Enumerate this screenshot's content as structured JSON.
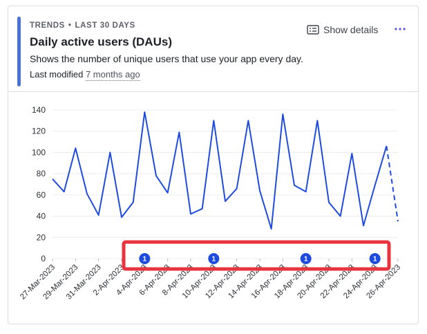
{
  "card": {
    "kicker_type": "TRENDS",
    "kicker_separator": "•",
    "kicker_range": "LAST 30 DAYS",
    "title": "Daily active users (DAUs)",
    "description": "Shows the number of unique users that use your app every day.",
    "modified_prefix": "Last modified",
    "modified_ago": "7 months ago",
    "show_details_label": "Show details",
    "show_details_icon": "details-list-icon",
    "more_icon": "more-dots-icon"
  },
  "colors": {
    "accent": "#4a72d4",
    "line": "#1d4bde",
    "annotation_marker": "#1d4bde",
    "highlight_box": "#e8343f"
  },
  "chart_data": {
    "type": "line",
    "title": "",
    "xlabel": "",
    "ylabel": "",
    "ylim": [
      0,
      140
    ],
    "yticks": [
      0,
      20,
      40,
      60,
      80,
      100,
      120,
      140
    ],
    "grid": true,
    "x": [
      "27-Mar-2023",
      "28-Mar-2023",
      "29-Mar-2023",
      "30-Mar-2023",
      "31-Mar-2023",
      "1-Apr-2023",
      "2-Apr-2023",
      "3-Apr-2023",
      "4-Apr-2023",
      "5-Apr-2023",
      "6-Apr-2023",
      "7-Apr-2023",
      "8-Apr-2023",
      "9-Apr-2023",
      "10-Apr-2023",
      "11-Apr-2023",
      "12-Apr-2023",
      "13-Apr-2023",
      "14-Apr-2023",
      "15-Apr-2023",
      "16-Apr-2023",
      "17-Apr-2023",
      "18-Apr-2023",
      "19-Apr-2023",
      "20-Apr-2023",
      "21-Apr-2023",
      "22-Apr-2023",
      "23-Apr-2023",
      "24-Apr-2023",
      "25-Apr-2023",
      "26-Apr-2023"
    ],
    "xtick_labels": [
      "27-Mar-2023",
      "29-Mar-2023",
      "31-Mar-2023",
      "2-Apr-2023",
      "4-Apr-2023",
      "6-Apr-2023",
      "8-Apr-2023",
      "10-Apr-2023",
      "12-Apr-2023",
      "14-Apr-2023",
      "16-Apr-2023",
      "18-Apr-2023",
      "20-Apr-2023",
      "22-Apr-2023",
      "24-Apr-2023",
      "26-Apr-2023"
    ],
    "series": [
      {
        "values": [
          75,
          63,
          104,
          61,
          41,
          100,
          39,
          53,
          138,
          78,
          62,
          119,
          42,
          47,
          130,
          54,
          66,
          130,
          64,
          28,
          136,
          69,
          63,
          130,
          53,
          40,
          99,
          31,
          69,
          106,
          35
        ],
        "incomplete_from": "25-Apr-2023"
      }
    ],
    "annotations": [
      {
        "x": "4-Apr-2023",
        "count": "1"
      },
      {
        "x": "10-Apr-2023",
        "count": "1"
      },
      {
        "x": "18-Apr-2023",
        "count": "1"
      },
      {
        "x": "24-Apr-2023",
        "count": "1"
      }
    ]
  }
}
